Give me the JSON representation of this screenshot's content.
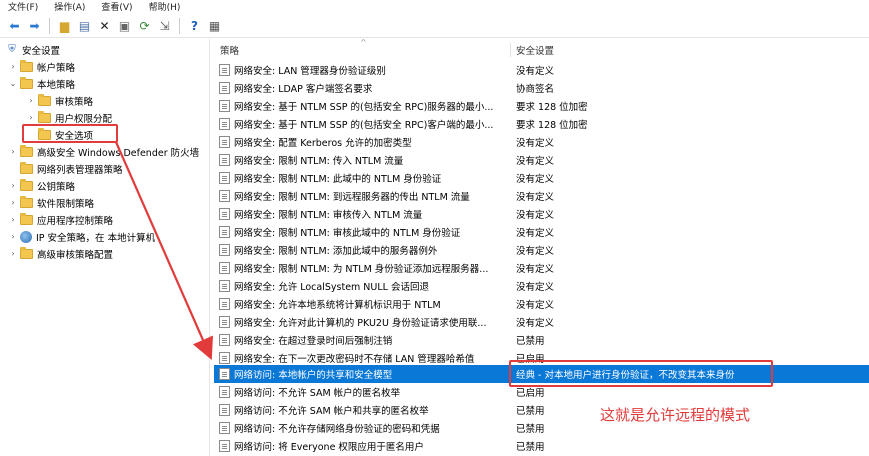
{
  "menu": [
    "文件(F)",
    "操作(A)",
    "查看(V)",
    "帮助(H)"
  ],
  "toolbar": [
    "back-icon",
    "forward-icon",
    "up-folder-icon",
    "show-hide-tree-icon",
    "delete-icon",
    "properties-icon",
    "refresh-icon",
    "export-icon",
    "help-icon",
    "console-icon"
  ],
  "tree": {
    "root": "安全设置",
    "items": [
      {
        "label": "帐户策略",
        "level": 1,
        "expander": "›"
      },
      {
        "label": "本地策略",
        "level": 1,
        "expander": "⌄"
      },
      {
        "label": "审核策略",
        "level": 2,
        "expander": "›"
      },
      {
        "label": "用户权限分配",
        "level": 2,
        "expander": "›"
      },
      {
        "label": "安全选项",
        "level": 2,
        "expander": ""
      },
      {
        "label": "高级安全 Windows Defender 防火墙",
        "level": 1,
        "expander": "›"
      },
      {
        "label": "网络列表管理器策略",
        "level": 1,
        "expander": ""
      },
      {
        "label": "公钥策略",
        "level": 1,
        "expander": "›"
      },
      {
        "label": "软件限制策略",
        "level": 1,
        "expander": "›"
      },
      {
        "label": "应用程序控制策略",
        "level": 1,
        "expander": "›"
      },
      {
        "label": "IP 安全策略，在 本地计算机",
        "level": 1,
        "expander": "›"
      },
      {
        "label": "高级审核策略配置",
        "level": 1,
        "expander": "›"
      }
    ]
  },
  "columns": {
    "policy": "策略",
    "setting": "安全设置"
  },
  "rows": [
    {
      "policy": "网络安全: LAN 管理器身份验证级别",
      "setting": "没有定义"
    },
    {
      "policy": "网络安全: LDAP 客户端签名要求",
      "setting": "协商签名"
    },
    {
      "policy": "网络安全: 基于 NTLM SSP 的(包括安全 RPC)服务器的最小...",
      "setting": "要求 128 位加密"
    },
    {
      "policy": "网络安全: 基于 NTLM SSP 的(包括安全 RPC)客户端的最小...",
      "setting": "要求 128 位加密"
    },
    {
      "policy": "网络安全: 配置 Kerberos 允许的加密类型",
      "setting": "没有定义"
    },
    {
      "policy": "网络安全: 限制 NTLM: 传入 NTLM 流量",
      "setting": "没有定义"
    },
    {
      "policy": "网络安全: 限制 NTLM: 此域中的 NTLM 身份验证",
      "setting": "没有定义"
    },
    {
      "policy": "网络安全: 限制 NTLM: 到远程服务器的传出 NTLM 流量",
      "setting": "没有定义"
    },
    {
      "policy": "网络安全: 限制 NTLM: 审核传入 NTLM 流量",
      "setting": "没有定义"
    },
    {
      "policy": "网络安全: 限制 NTLM: 审核此域中的 NTLM 身份验证",
      "setting": "没有定义"
    },
    {
      "policy": "网络安全: 限制 NTLM: 添加此域中的服务器例外",
      "setting": "没有定义"
    },
    {
      "policy": "网络安全: 限制 NTLM: 为 NTLM 身份验证添加远程服务器...",
      "setting": "没有定义"
    },
    {
      "policy": "网络安全: 允许 LocalSystem NULL 会话回退",
      "setting": "没有定义"
    },
    {
      "policy": "网络安全: 允许本地系统将计算机标识用于 NTLM",
      "setting": "没有定义"
    },
    {
      "policy": "网络安全: 允许对此计算机的 PKU2U 身份验证请求使用联...",
      "setting": "没有定义"
    },
    {
      "policy": "网络安全: 在超过登录时间后强制注销",
      "setting": "已禁用"
    },
    {
      "policy": "网络安全: 在下一次更改密码时不存储 LAN 管理器哈希值",
      "setting": "已启用"
    },
    {
      "policy": "网络访问: 本地帐户的共享和安全模型",
      "setting": "经典 - 对本地用户进行身份验证，不改变其本来身份",
      "selected": true
    },
    {
      "policy": "网络访问: 不允许 SAM 帐户的匿名枚举",
      "setting": "已启用"
    },
    {
      "policy": "网络访问: 不允许 SAM 帐户和共享的匿名枚举",
      "setting": "已禁用"
    },
    {
      "policy": "网络访问: 不允许存储网络身份验证的密码和凭据",
      "setting": "已禁用"
    },
    {
      "policy": "网络访问: 将 Everyone 权限应用于匿名用户",
      "setting": "已禁用"
    }
  ],
  "annotation": {
    "text": "这就是允许远程的模式",
    "color": "#e23b3b"
  },
  "colors": {
    "selection": "#0a78d7",
    "folder": "#f2c64f"
  }
}
